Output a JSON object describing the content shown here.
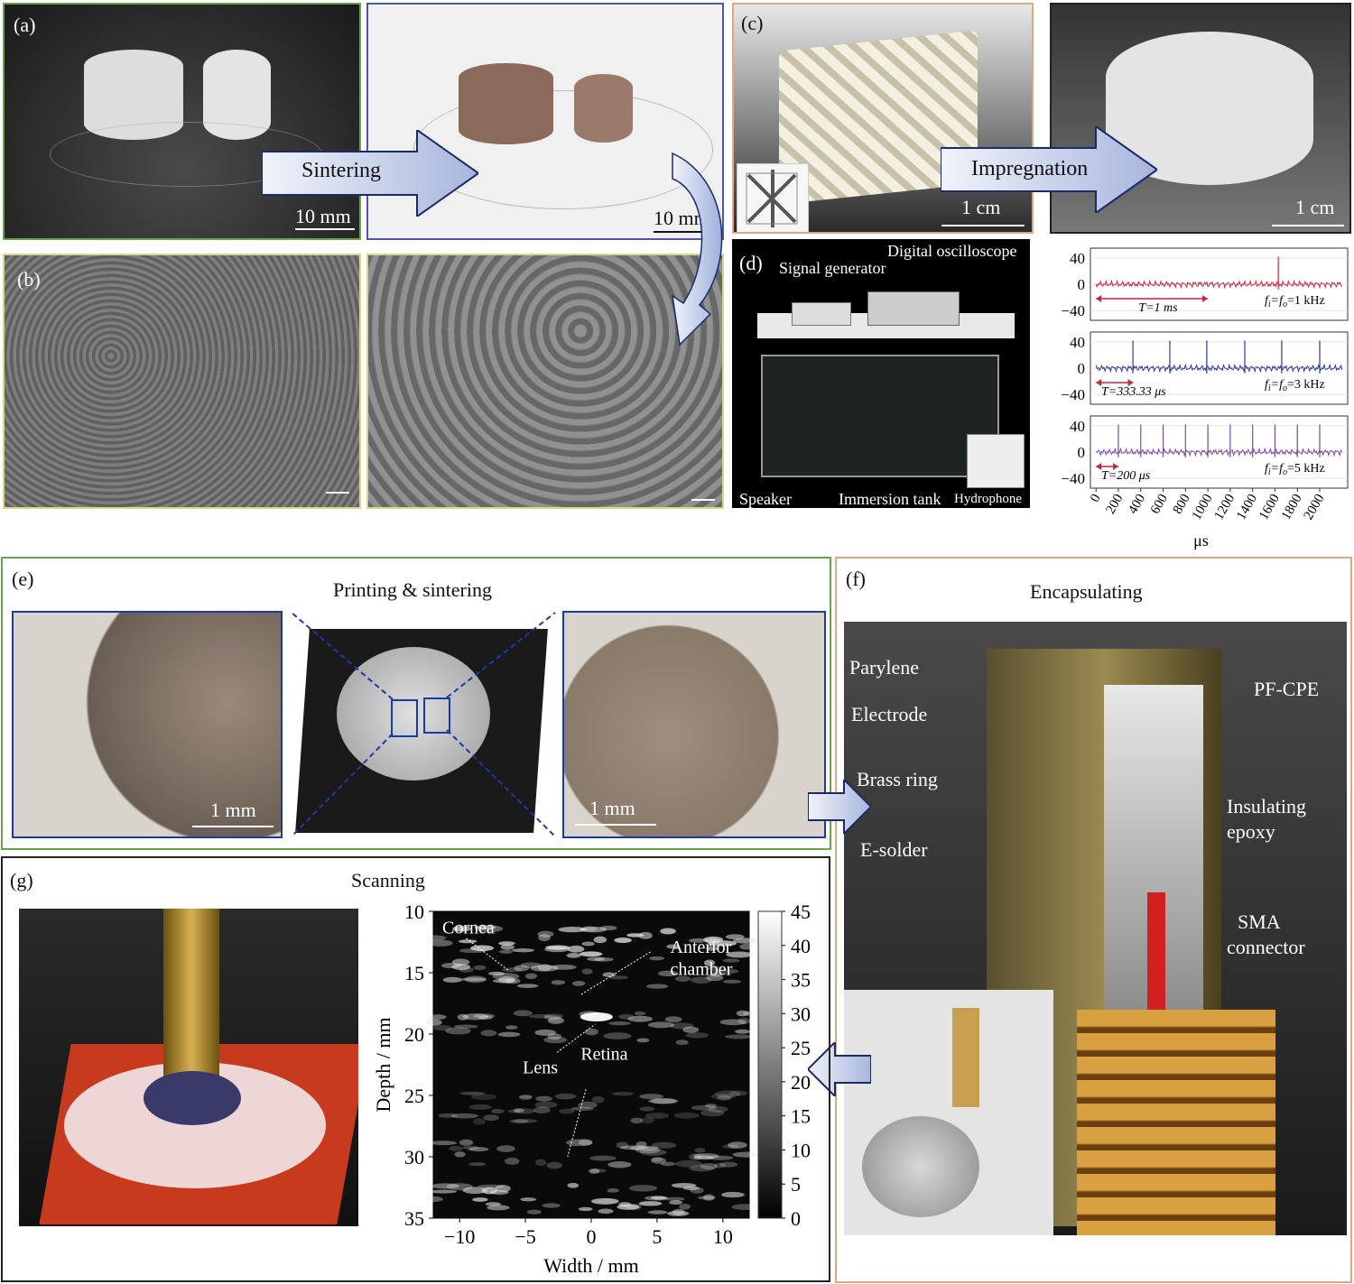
{
  "panel_a": {
    "label": "(a)",
    "scalebar_left": "10 mm",
    "scalebar_right": "10 mm",
    "arrow": "Sintering"
  },
  "panel_b": {
    "label": "(b)"
  },
  "panel_c": {
    "label": "(c)",
    "scalebar_left": "1 cm",
    "scalebar_right": "1 cm",
    "arrow": "Impregnation"
  },
  "panel_d": {
    "label": "(d)",
    "signal_generator": "Signal generator",
    "oscilloscope": "Digital oscilloscope",
    "speaker": "Speaker",
    "tank": "Immersion tank",
    "hydrophone": "Hydrophone"
  },
  "panel_e": {
    "label": "(e)",
    "title": "Printing & sintering",
    "scalebar_left": "1 mm",
    "scalebar_right": "1 mm"
  },
  "panel_f": {
    "label": "(f)",
    "title": "Encapsulating",
    "callouts": {
      "parylene": "Parylene",
      "electrode": "Electrode",
      "brass_ring": "Brass ring",
      "e_solder": "E-solder",
      "pf_cpe": "PF-CPE",
      "insulating_1": "Insulating",
      "insulating_2": "epoxy",
      "sma_1": "SMA",
      "sma_2": "connector"
    }
  },
  "panel_g": {
    "label": "(g)",
    "title": "Scanning",
    "annotations": {
      "cornea": "Cornea",
      "anterior_1": "Anterior",
      "anterior_2": "chamber",
      "lens": "Lens",
      "retina": "Retina"
    }
  },
  "chart_data": [
    {
      "type": "line",
      "panel": "d",
      "xlabel": "μs",
      "x_ticks": [
        "0",
        "200",
        "400",
        "600",
        "800",
        "1000",
        "1200",
        "1400",
        "1600",
        "1800",
        "2000"
      ],
      "y_ticks": [
        "40",
        "0",
        "−40"
      ],
      "xlim": [
        -50,
        2250
      ],
      "ylim": [
        -55,
        55
      ],
      "colors": {
        "1kHz": "#c8283c",
        "3kHz": "#2a3a9a",
        "5kHz": "#7a4aa8"
      },
      "series": [
        {
          "name": "fi=fo=1 kHz",
          "period_label": "T=1 ms",
          "freq_text": "=1 kHz",
          "period_us": 1000,
          "peak_x": [
            1630
          ],
          "baseline": 0
        },
        {
          "name": "fi=fo=3 kHz",
          "period_label": "T=333.33 μs",
          "freq_text": "=3 kHz",
          "period_us": 333.33,
          "peak_x": [
            330,
            660,
            990,
            1330,
            1660,
            2000
          ],
          "baseline": 0
        },
        {
          "name": "fi=fo=5 kHz",
          "period_label": "T=200 μs",
          "freq_text": "=5 kHz",
          "period_us": 200,
          "peak_x": [
            200,
            400,
            600,
            800,
            1000,
            1200,
            1400,
            1600,
            1800,
            2000
          ],
          "baseline": 0
        }
      ]
    },
    {
      "type": "heatmap",
      "panel": "g",
      "xlabel": "Width / mm",
      "ylabel": "Depth / mm",
      "x_ticks": [
        "−10",
        "−5",
        "0",
        "5",
        "10"
      ],
      "y_ticks": [
        "10",
        "15",
        "20",
        "25",
        "30",
        "35"
      ],
      "xlim": [
        -12,
        12
      ],
      "ylim": [
        10,
        35
      ],
      "colorbar_ticks": [
        "45",
        "40",
        "35",
        "30",
        "25",
        "20",
        "15",
        "10",
        "5",
        "0"
      ],
      "colorbar_range": [
        0,
        45
      ]
    }
  ]
}
